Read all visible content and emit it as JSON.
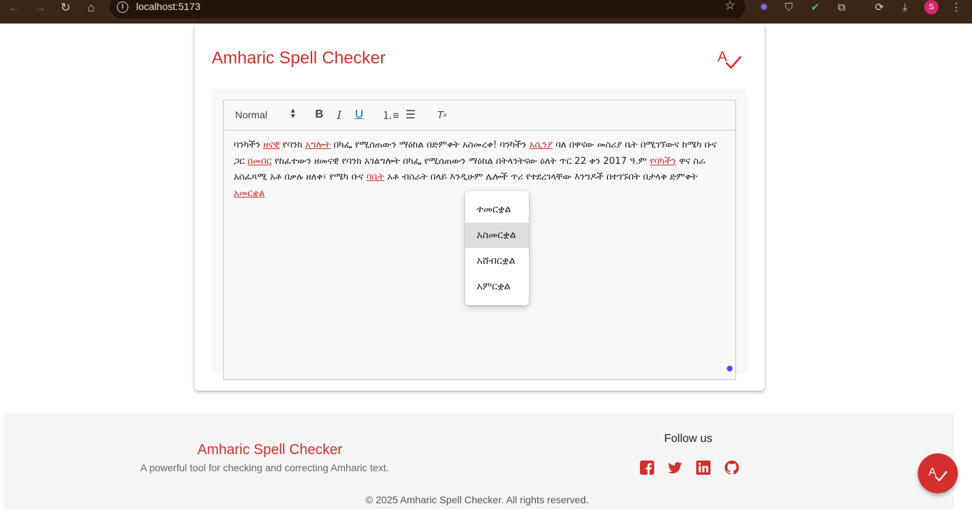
{
  "browser": {
    "url": "localhost:5173",
    "avatar_letter": "S"
  },
  "app": {
    "title": "Amharic Spell Checker",
    "accent_color": "#d0312d"
  },
  "toolbar": {
    "format_select": "Normal",
    "bold": "B",
    "italic": "I",
    "underline": "U",
    "clear_format": "Tx"
  },
  "editor": {
    "segments": [
      {
        "text": "ባንካችን ",
        "error": false
      },
      {
        "text": "ዘናዊ",
        "error": true
      },
      {
        "text": " የባንክ ",
        "error": false
      },
      {
        "text": "አግሎት",
        "error": true
      },
      {
        "text": " በካፌ የሚሰጠውን ማዕከል በድምቀት አስመረቀ! ባንካችን ",
        "error": false
      },
      {
        "text": "አሲንያ",
        "error": true
      },
      {
        "text": " ባለ በዋናው መስሪያ ቤት በሚገኘውና ከሜካ ቡና ጋር ",
        "error": false
      },
      {
        "text": "በመበር",
        "error": true
      },
      {
        "text": " የከፈተውን ዘመናዊ የባንክ አገልግሎት በካፌ የሚሰጠውን ማዕከል በትላንትናው ዕለት ጥር 22 ቀን 2017 ዓ.ም ",
        "error": false
      },
      {
        "text": "የባካችን",
        "error": true
      },
      {
        "text": " ዋና ስራ አስፈጻሚ አቶ በቃሉ ዘለቀ፣ የሜካ ቡና ",
        "error": false
      },
      {
        "text": "ባቤት",
        "error": true
      },
      {
        "text": " አቶ ብስራት በላይ እንዲሁም ሌሎች ጥሪ የተደረገላቸው እንግዶች በተገኙበት በታላቅ ድምቀት ",
        "error": false
      },
      {
        "text": "አመርቋል",
        "error": true
      }
    ],
    "suggestions": [
      "ተመርቋል",
      "አስመርቋል",
      "አሸብርቋል",
      "አምርቋል"
    ],
    "highlighted_suggestion": "አስመርቋል"
  },
  "footer": {
    "title": "Amharic Spell Checker",
    "tagline": "A powerful tool for checking and correcting Amharic text.",
    "follow_label": "Follow us",
    "social": [
      "facebook-icon",
      "twitter-icon",
      "linkedin-icon",
      "github-icon"
    ],
    "copyright": "© 2025 Amharic Spell Checker. All rights reserved."
  }
}
